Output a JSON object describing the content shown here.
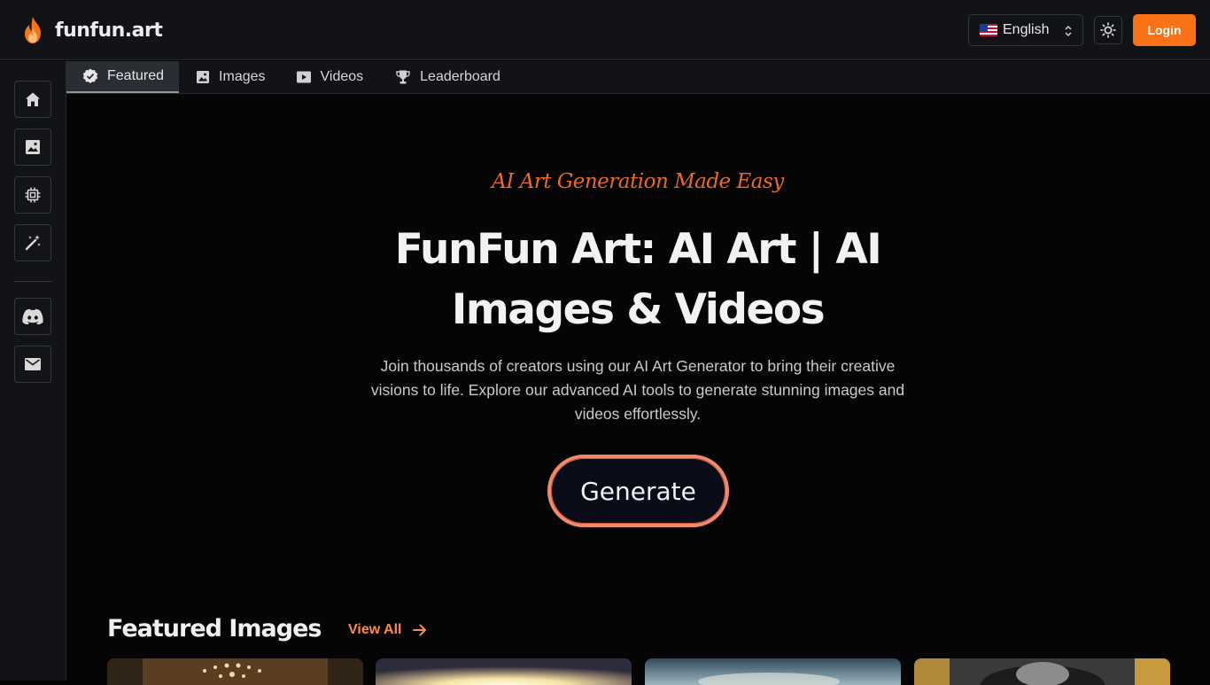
{
  "brand": {
    "name": "funfun.art"
  },
  "header": {
    "language": "English",
    "login_label": "Login"
  },
  "tabs": [
    {
      "label": "Featured",
      "icon": "verified-badge-icon",
      "active": true
    },
    {
      "label": "Images",
      "icon": "image-icon",
      "active": false
    },
    {
      "label": "Videos",
      "icon": "video-icon",
      "active": false
    },
    {
      "label": "Leaderboard",
      "icon": "trophy-icon",
      "active": false
    }
  ],
  "sidebar": {
    "items": [
      {
        "name": "home",
        "icon": "home-icon"
      },
      {
        "name": "images",
        "icon": "image-icon"
      },
      {
        "name": "models",
        "icon": "chip-icon"
      },
      {
        "name": "generate",
        "icon": "magic-wand-icon"
      },
      {
        "name": "discord",
        "icon": "discord-icon"
      },
      {
        "name": "email",
        "icon": "mail-icon"
      }
    ]
  },
  "hero": {
    "tagline": "AI Art Generation Made Easy",
    "title": "FunFun Art: AI Art | AI Images & Videos",
    "description": "Join thousands of creators using our AI Art Generator to bring their creative visions to life. Explore our advanced AI tools to generate stunning images and videos effortlessly.",
    "cta_label": "Generate"
  },
  "featured": {
    "title": "Featured Images",
    "view_all_label": "View All"
  },
  "colors": {
    "accent": "#f97316",
    "tagline": "#ea6a22",
    "background": "#050505",
    "panel": "#111317"
  }
}
